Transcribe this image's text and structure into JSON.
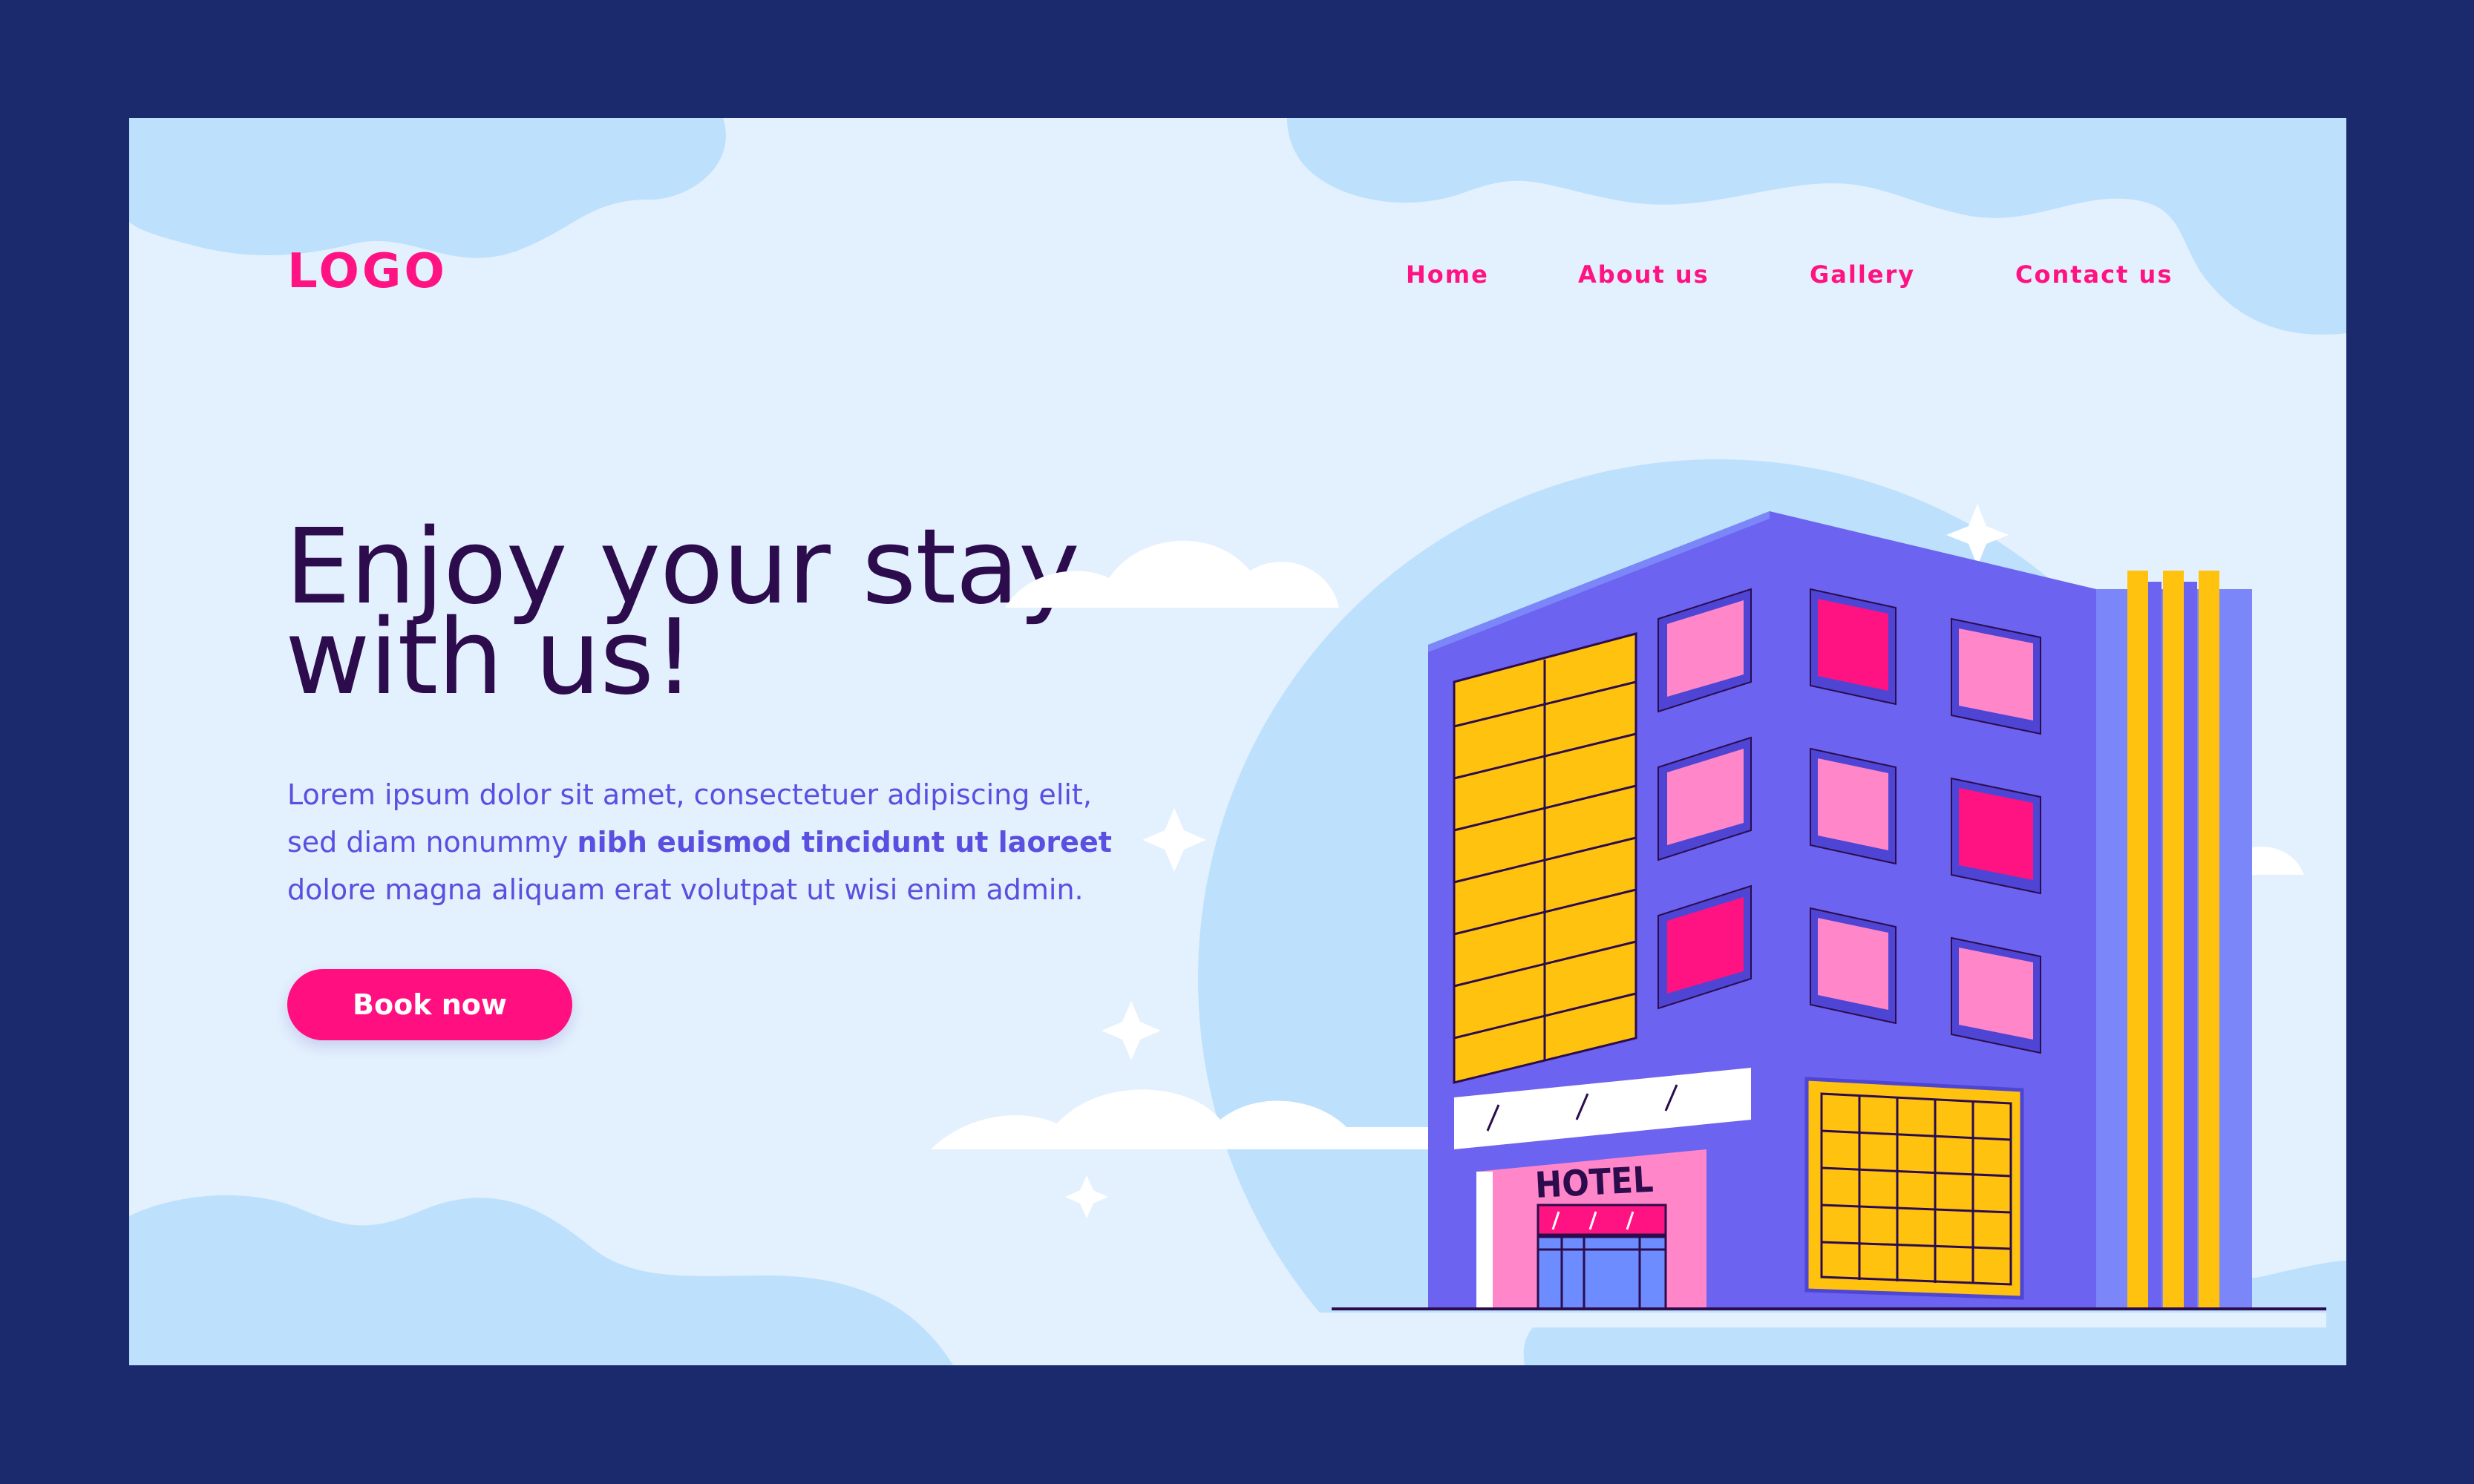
{
  "header": {
    "logo": "LOGO"
  },
  "nav": {
    "items": [
      "Home",
      "About us",
      "Gallery",
      "Contact us"
    ]
  },
  "hero": {
    "title_line1": "Enjoy your stay",
    "title_line2": "with us!",
    "desc_part1": "Lorem ipsum dolor sit amet, consectetuer adipiscing elit, sed diam nonummy ",
    "desc_bold": "nibh euismod tincidunt ut laoreet",
    "desc_part2": " dolore magna aliquam erat volutpat ut wisi enim admin.",
    "cta_label": "Book now"
  },
  "illustration": {
    "sign_text": "HOTEL"
  },
  "colors": {
    "frame": "#1a2a6c",
    "page_bg": "#e3f0fd",
    "accent_pink": "#ff1281",
    "title": "#2c0c4d",
    "body_text": "#5a4fe0",
    "building": "#6c63f0",
    "yellow": "#ffc20e"
  }
}
